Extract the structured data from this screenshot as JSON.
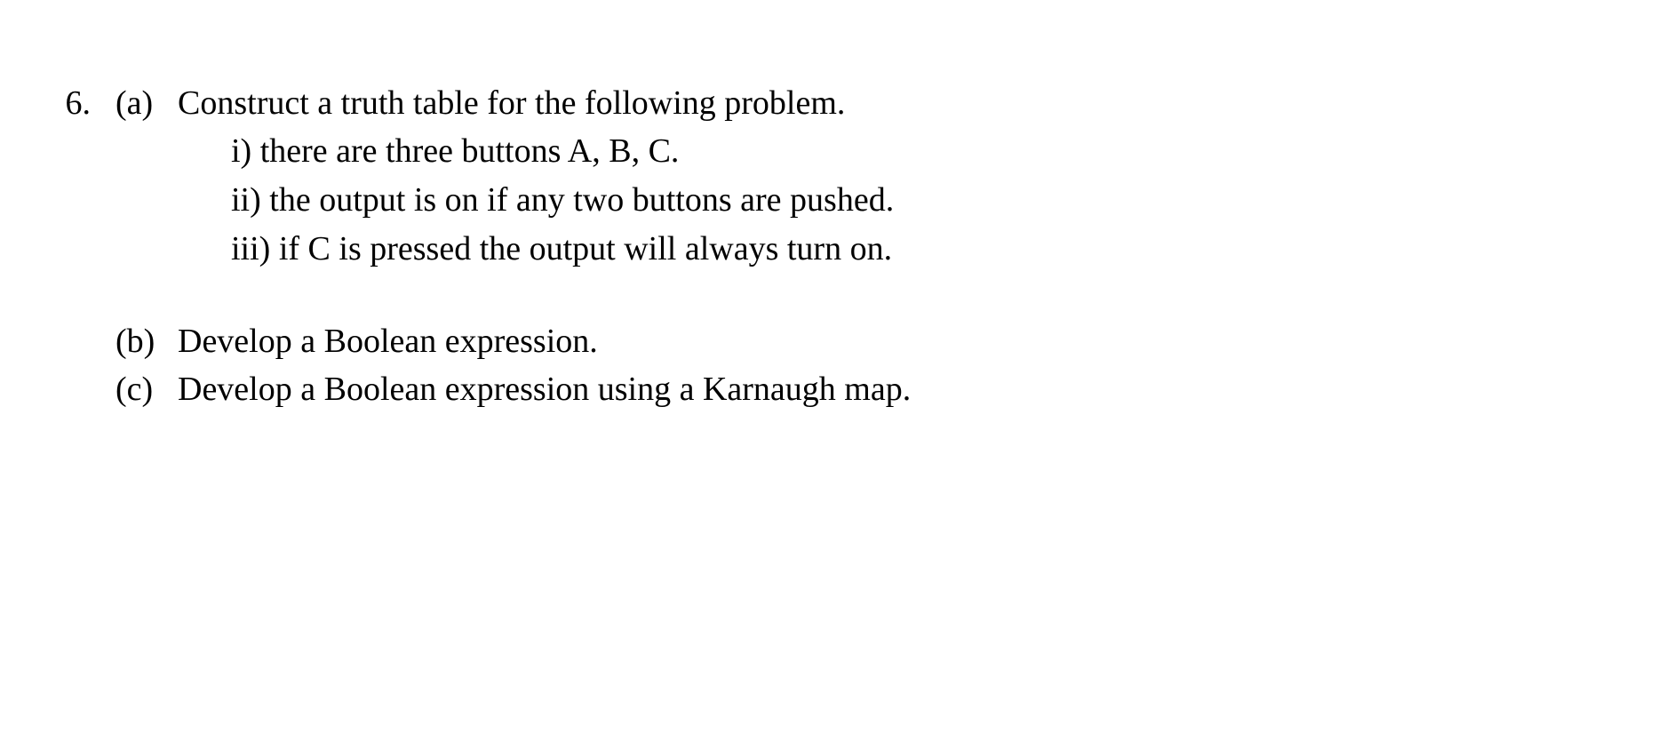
{
  "problem": {
    "number": "6.",
    "parts": {
      "a": {
        "label": "(a)",
        "prompt": "Construct a truth table for the following problem.",
        "sub_items": [
          {
            "label": "i)",
            "text": "there are three buttons A, B, C."
          },
          {
            "label": "ii)",
            "text": "the output is on if any two buttons are pushed."
          },
          {
            "label": "iii)",
            "text": "if C is pressed the output will always turn on."
          }
        ]
      },
      "b": {
        "label": "(b)",
        "text": "Develop a Boolean expression."
      },
      "c": {
        "label": "(c)",
        "text": "Develop a Boolean expression using a Karnaugh map."
      }
    }
  }
}
